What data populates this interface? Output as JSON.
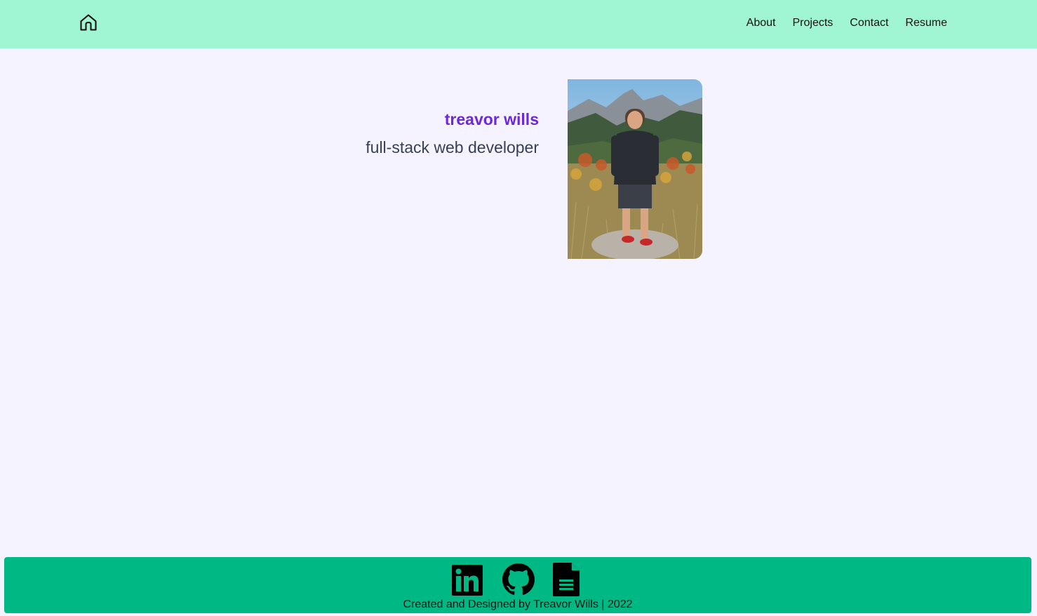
{
  "header": {
    "home_icon": "home-icon",
    "nav": [
      "About",
      "Projects",
      "Contact",
      "Resume"
    ]
  },
  "hero": {
    "name": "treavor wills",
    "title": "full-stack web developer",
    "photo": "profile-photo"
  },
  "footer": {
    "icons": [
      "linkedin-icon",
      "github-icon",
      "document-icon"
    ],
    "credit": "Created and Designed by Treavor Wills | 2022"
  },
  "colors": {
    "header_bg": "#a0f5d2",
    "page_bg": "#f5f3ff",
    "footer_bg": "#00b884",
    "accent": "#6d28d9"
  }
}
